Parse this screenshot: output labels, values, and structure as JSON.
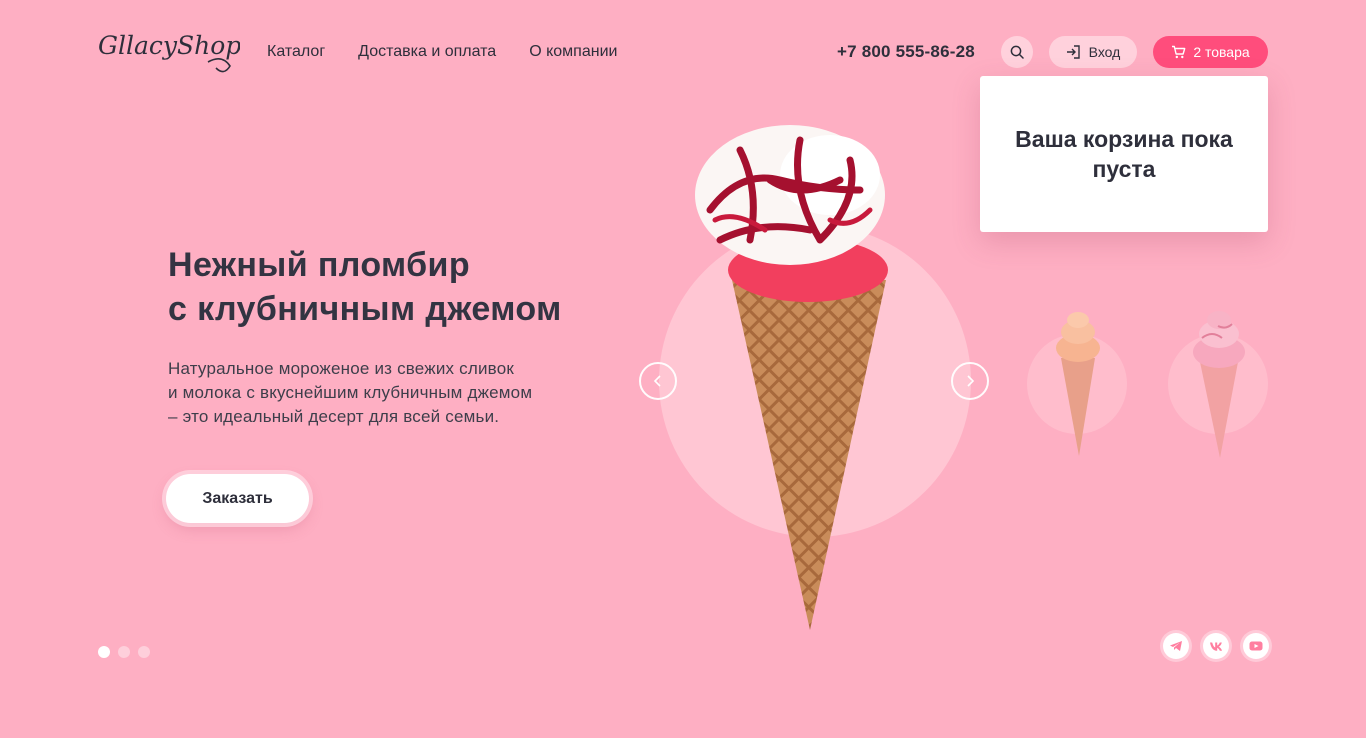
{
  "header": {
    "logo_text": "GllacyShop",
    "nav": [
      "Каталог",
      "Доставка и оплата",
      "О компании"
    ],
    "phone": "+7 800 555-86-28",
    "login_label": "Вход",
    "cart_label": "2 товара"
  },
  "cart_popup": {
    "message": "Ваша корзина пока пуста"
  },
  "hero": {
    "title_lines": [
      "Нежный пломбир",
      "с клубничным джемом"
    ],
    "text_lines": [
      "Натуральное мороженое из свежих сливок",
      "и молока с вкуснейшим клубничным джемом",
      "– это идеальный десерт для всей семьи."
    ],
    "order_label": "Заказать"
  },
  "slider": {
    "slide_count": 3,
    "active_slide": 1
  },
  "icons": {
    "search": "search-icon",
    "login": "login-icon",
    "cart": "cart-icon",
    "prev": "chevron-left-icon",
    "next": "chevron-right-icon",
    "socials": [
      "telegram-icon",
      "vk-icon",
      "youtube-icon"
    ]
  },
  "colors": {
    "background": "#feafc3",
    "accent": "#ff4d7c",
    "soft_pink": "#ffd1dc",
    "text": "#2e2f3b"
  }
}
